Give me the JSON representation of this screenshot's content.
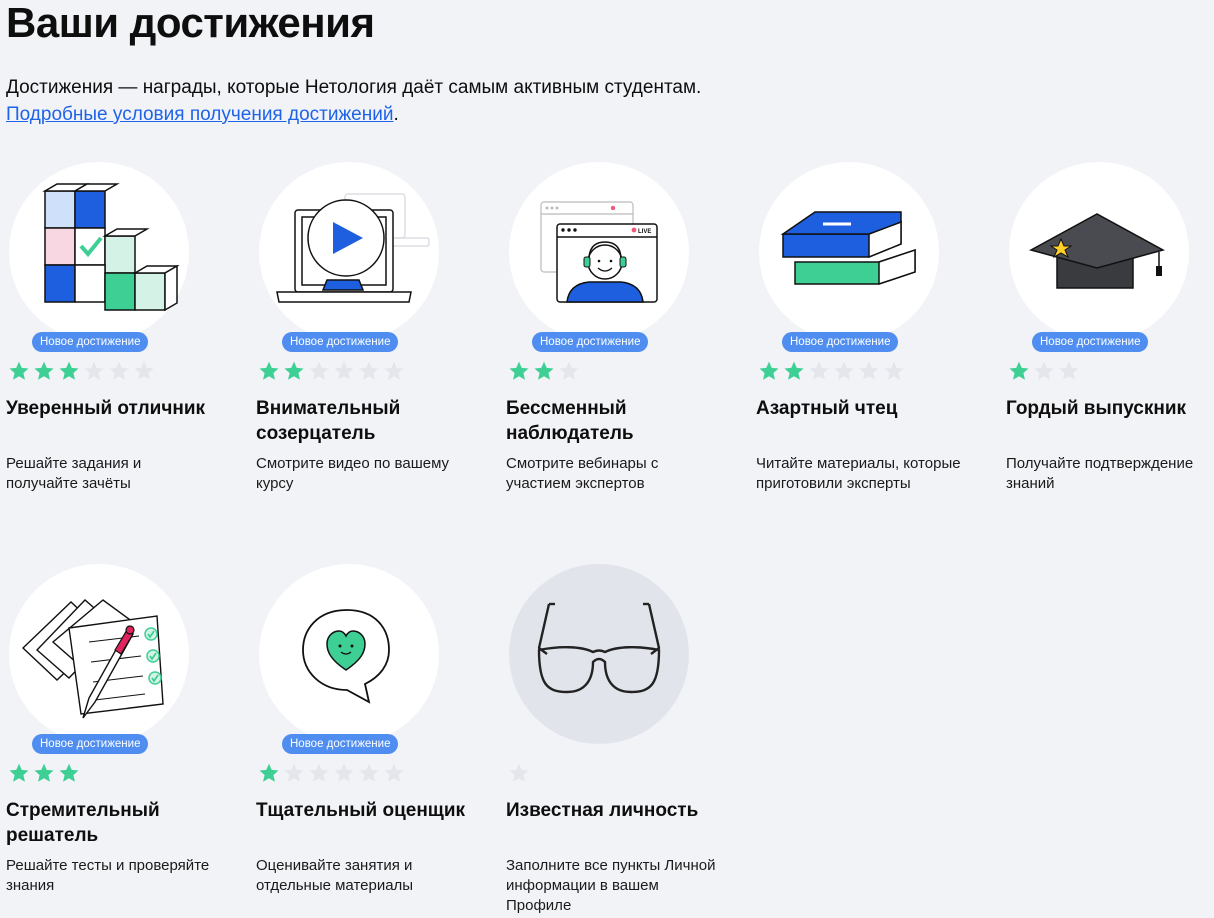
{
  "header": {
    "title": "Ваши достижения",
    "intro_text": "Достижения — награды, которые Нетология даёт самым активным студентам.",
    "link_label": "Подробные условия получения достижений",
    "after_link": "."
  },
  "colors": {
    "background": "#f2f3f7",
    "badge": "#4f8ef0",
    "star_filled": "#3ecf94",
    "star_empty": "#e4e6ec",
    "link": "#1e63e8"
  },
  "achievements": [
    {
      "title": "Уверенный отличник",
      "desc": "Решайте задания и получайте зачёты",
      "badge": "Новое достижение",
      "stars_filled": 3,
      "stars_total": 6,
      "icon": "cubes-icon"
    },
    {
      "title": "Внимательный созерцатель",
      "desc": "Смотрите видео по вашему курсу",
      "badge": "Новое достижение",
      "stars_filled": 2,
      "stars_total": 6,
      "icon": "laptop-play-icon"
    },
    {
      "title": "Бессменный наблюдатель",
      "desc": "Смотрите вебинары с участием экспертов",
      "badge": "Новое достижение",
      "stars_filled": 2,
      "stars_total": 3,
      "icon": "webinar-icon"
    },
    {
      "title": "Азартный чтец",
      "desc": "Читайте материалы, которые приготовили эксперты",
      "badge": "Новое достижение",
      "stars_filled": 2,
      "stars_total": 6,
      "icon": "books-icon"
    },
    {
      "title": "Гордый выпускник",
      "desc": "Получайте подтверждение знаний",
      "badge": "Новое достижение",
      "stars_filled": 1,
      "stars_total": 3,
      "icon": "graduation-cap-icon"
    },
    {
      "title": "Стремительный решатель",
      "desc": "Решайте тесты и проверяйте знания",
      "badge": "Новое достижение",
      "stars_filled": 3,
      "stars_total": 3,
      "icon": "tests-icon"
    },
    {
      "title": "Тщательный оценщик",
      "desc": "Оценивайте занятия и отдельные материалы",
      "badge": "Новое достижение",
      "stars_filled": 1,
      "stars_total": 6,
      "icon": "heart-bubble-icon"
    },
    {
      "title": "Известная личность",
      "desc": "Заполните все пункты Личной информации в вашем Профиле",
      "badge": "",
      "stars_filled": 0,
      "stars_total": 1,
      "icon": "glasses-icon"
    }
  ]
}
